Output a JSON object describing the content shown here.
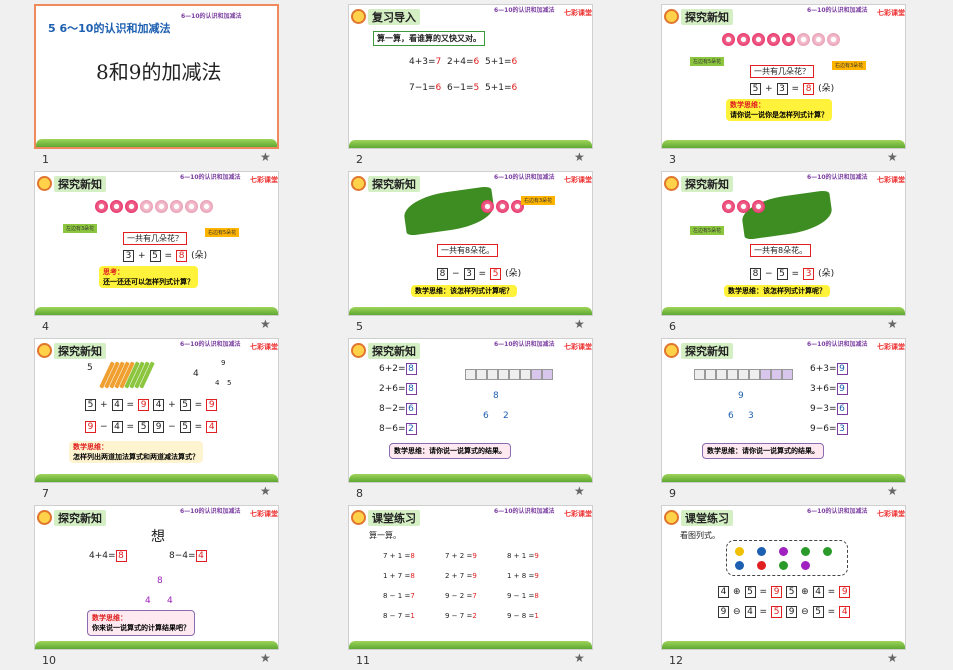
{
  "colors": {
    "accent_red": "#e02020",
    "select_border": "#f08a5d",
    "header_bg": "#d5efc5",
    "yellow_note": "#fff23a"
  },
  "slides": [
    {
      "num": "1",
      "title_small": "5 6～10的认识和加减法",
      "title_big": "8和9的加减法",
      "top_sub": "6—10的认识和加减法"
    },
    {
      "num": "2",
      "header": "复习导入",
      "top_sub": "6—10的认识和加减法",
      "logo": "七彩课堂",
      "prompt": "算一算，看谁算的又快又对。",
      "eq": [
        [
          "4+3=",
          "7"
        ],
        [
          "2+4=",
          "6"
        ],
        [
          "5+1=",
          "6"
        ],
        [
          "7−1=",
          "6"
        ],
        [
          "6−1=",
          "5"
        ],
        [
          "5+1=",
          "6"
        ]
      ]
    },
    {
      "num": "3",
      "header": "探究新知",
      "top_sub": "6—10的认识和加减法",
      "logo": "七彩课堂",
      "tag_left": "左边有5朵花",
      "tag_right": "右边有3朵花",
      "q": "一共有几朵花？",
      "eq": [
        "5",
        "+",
        "3",
        "=",
        "8",
        "(朵)"
      ],
      "note1": "数学思维：",
      "note2": "请你说一说你是怎样列式计算？"
    },
    {
      "num": "4",
      "header": "探究新知",
      "top_sub": "6—10的认识和加减法",
      "logo": "七彩课堂",
      "tag_left": "左边有3朵花",
      "tag_right": "右边有5朵花",
      "q": "一共有几朵花？",
      "eq": [
        "3",
        "+",
        "5",
        "=",
        "8",
        "(朵)"
      ],
      "note1": "思考：",
      "note2": "还一还还可以怎样列式计算？"
    },
    {
      "num": "5",
      "header": "探究新知",
      "top_sub": "6—10的认识和加减法",
      "logo": "七彩课堂",
      "tag_right": "右边有3朵花",
      "q": "一共有8朵花。",
      "eq": [
        "8",
        "−",
        "3",
        "=",
        "5",
        "(朵)"
      ],
      "note": "数学思维：该怎样列式计算呢？"
    },
    {
      "num": "6",
      "header": "探究新知",
      "top_sub": "6—10的认识和加减法",
      "logo": "七彩课堂",
      "tag_left": "左边有5朵花",
      "q": "一共有8朵花。",
      "eq": [
        "8",
        "−",
        "5",
        "=",
        "3",
        "(朵)"
      ],
      "note": "数学思维：该怎样列式计算呢？"
    },
    {
      "num": "7",
      "header": "探究新知",
      "top_sub": "6—10的认识和加减法",
      "logo": "七彩课堂",
      "n5": "5",
      "n4": "4",
      "tree_top": "9",
      "tree_l": "4",
      "tree_r": "5",
      "rows": [
        [
          "5",
          "+",
          "4",
          "=",
          "9",
          "4",
          "+",
          "5",
          "=",
          "9"
        ],
        [
          "9",
          "−",
          "4",
          "=",
          "5",
          "9",
          "−",
          "5",
          "=",
          "4"
        ]
      ],
      "note1": "数学思维：",
      "note2": "怎样列出两道加法算式和两道减法算式？"
    },
    {
      "num": "8",
      "header": "探究新知",
      "top_sub": "6—10的认识和加减法",
      "logo": "七彩课堂",
      "eq": [
        [
          "6+2=",
          "8"
        ],
        [
          "2+6=",
          "8"
        ],
        [
          "8−2=",
          "6"
        ],
        [
          "8−6=",
          "2"
        ]
      ],
      "tree_top": "8",
      "tree_l": "6",
      "tree_r": "2",
      "note": "数学思维：请你说一说算式的结果。"
    },
    {
      "num": "9",
      "header": "探究新知",
      "top_sub": "6—10的认识和加减法",
      "logo": "七彩课堂",
      "eq": [
        [
          "6+3=",
          "9"
        ],
        [
          "3+6=",
          "9"
        ],
        [
          "9−3=",
          "6"
        ],
        [
          "9−6=",
          "3"
        ]
      ],
      "tree_top": "9",
      "tree_l": "6",
      "tree_r": "3",
      "note": "数学思维：请你说一说算式的结果。"
    },
    {
      "num": "10",
      "header": "探究新知",
      "top_sub": "6—10的认识和加减法",
      "logo": "七彩课堂",
      "think": "想",
      "eq_l": [
        "4+4=",
        "8"
      ],
      "eq_r": [
        "8−4=",
        "4"
      ],
      "tree_top": "8",
      "tree_l": "4",
      "tree_r": "4",
      "note1": "数学思维：",
      "note2": "你来说一说算式的计算结果吧？"
    },
    {
      "num": "11",
      "header": "课堂练习",
      "top_sub": "6—10的认识和加减法",
      "logo": "七彩课堂",
      "prompt": "算一算。",
      "rows": [
        [
          [
            "7 + 1 =",
            "8"
          ],
          [
            "7 + 2 =",
            "9"
          ],
          [
            "8 + 1 =",
            "9"
          ]
        ],
        [
          [
            "1 + 7 =",
            "8"
          ],
          [
            "2 + 7 =",
            "9"
          ],
          [
            "1 + 8 =",
            "9"
          ]
        ],
        [
          [
            "8 − 1 =",
            "7"
          ],
          [
            "9 − 2 =",
            "7"
          ],
          [
            "9 − 1 =",
            "8"
          ]
        ],
        [
          [
            "8 − 7 =",
            "1"
          ],
          [
            "9 − 7 =",
            "2"
          ],
          [
            "9 − 8 =",
            "1"
          ]
        ]
      ]
    },
    {
      "num": "12",
      "header": "课堂练习",
      "top_sub": "6—10的认识和加减法",
      "logo": "七彩课堂",
      "prompt": "看图列式。",
      "rows": [
        [
          "4",
          "⊕",
          "5",
          "=",
          "9",
          "5",
          "⊕",
          "4",
          "=",
          "9"
        ],
        [
          "9",
          "⊖",
          "4",
          "=",
          "5",
          "9",
          "⊖",
          "5",
          "=",
          "4"
        ]
      ]
    }
  ]
}
